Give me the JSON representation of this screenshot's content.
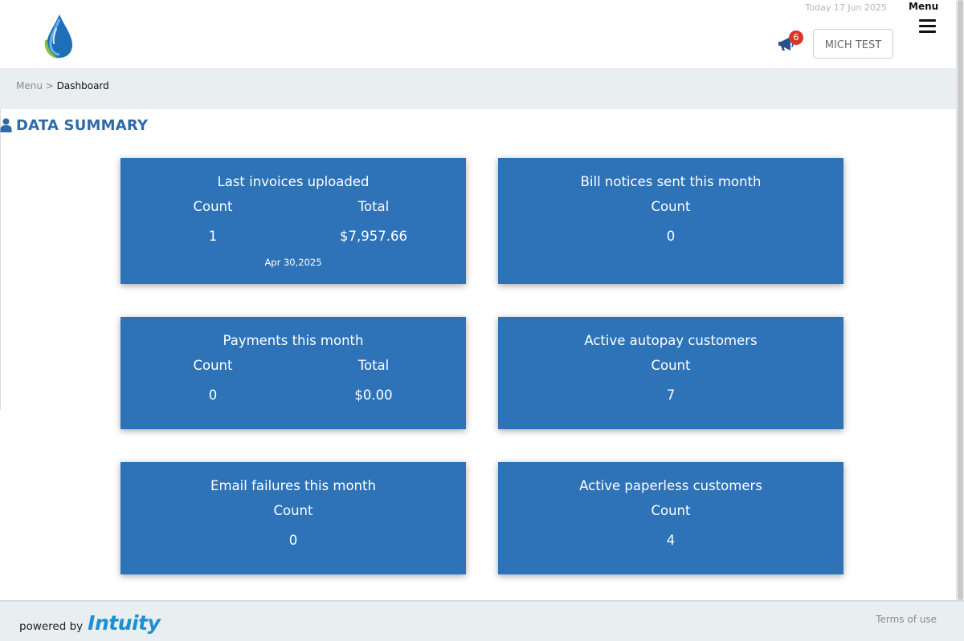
{
  "header": {
    "today_text": "Today 17 Jun 2025",
    "menu_label": "Menu",
    "notification_count": "6",
    "user_button": "MICH TEST"
  },
  "breadcrumb": {
    "parent": "Menu",
    "separator": ">",
    "current": "Dashboard"
  },
  "section": {
    "title": "DATA SUMMARY"
  },
  "cards": [
    {
      "title": "Last invoices uploaded",
      "count_label": "Count",
      "total_label": "Total",
      "count_value": "1",
      "total_value": "$7,957.66",
      "date": "Apr 30,2025"
    },
    {
      "title": "Bill notices sent this month",
      "count_label": "Count",
      "count_value": "0"
    },
    {
      "title": "Payments this month",
      "count_label": "Count",
      "total_label": "Total",
      "count_value": "0",
      "total_value": "$0.00"
    },
    {
      "title": "Active autopay customers",
      "count_label": "Count",
      "count_value": "7"
    },
    {
      "title": "Email failures this month",
      "count_label": "Count",
      "count_value": "0"
    },
    {
      "title": "Active paperless customers",
      "count_label": "Count",
      "count_value": "4"
    }
  ],
  "footer": {
    "powered_text": "powered by",
    "brand": "Intuity",
    "terms": "Terms of use"
  },
  "colors": {
    "card_blue": "#2e73b8",
    "title_blue": "#2f6aa8",
    "band_gray": "#e9eef1",
    "badge_red": "#d9362b",
    "brand_blue": "#1d8fd1"
  },
  "icons": {
    "logo": "water-drop-logo-icon",
    "notifications": "megaphone-icon",
    "menu": "hamburger-icon",
    "section": "person-icon"
  }
}
